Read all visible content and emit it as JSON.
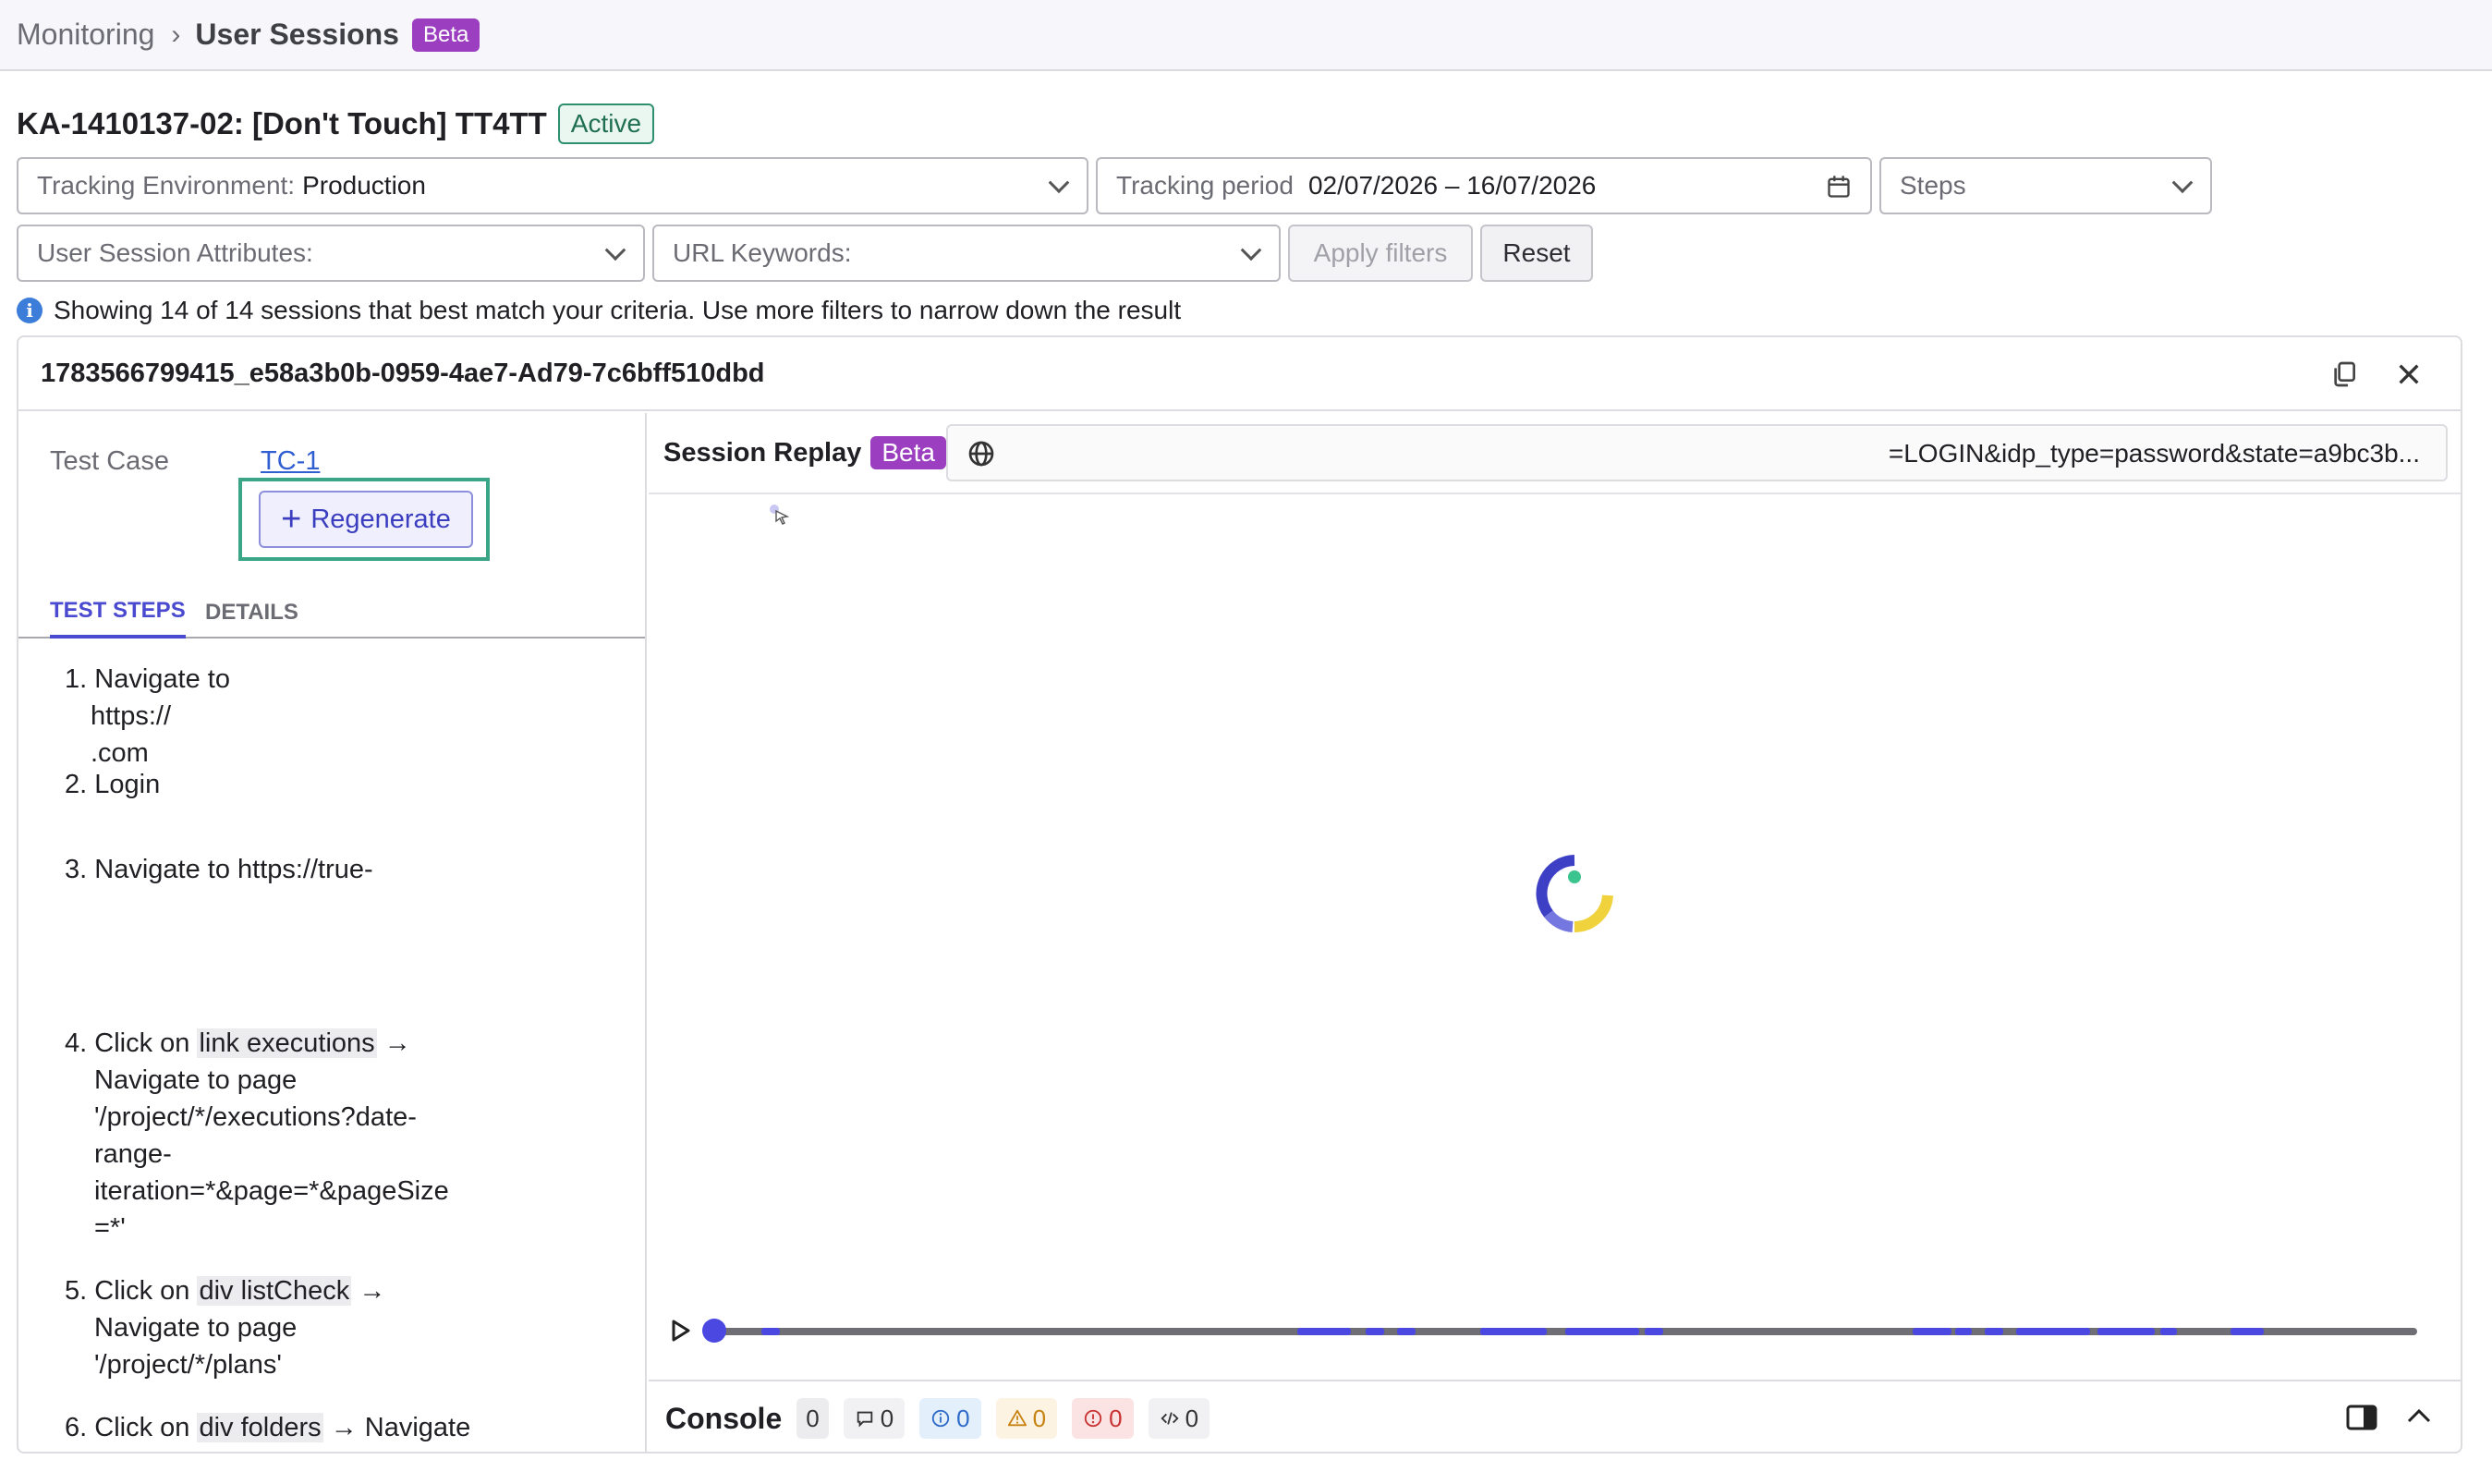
{
  "breadcrumb": {
    "parent": "Monitoring",
    "separator": "›",
    "current": "User Sessions",
    "badge": "Beta"
  },
  "project": {
    "title": "KA-1410137-02: [Don't Touch] TT4TT",
    "status": "Active"
  },
  "filters": {
    "environment_label": "Tracking Environment:",
    "environment_value": "Production",
    "period_label": "Tracking period",
    "period_value": "02/07/2026 – 16/07/2026",
    "steps_label": "Steps",
    "attributes_label": "User Session Attributes:",
    "url_keywords_label": "URL Keywords:",
    "apply_label": "Apply filters",
    "reset_label": "Reset"
  },
  "info_text": "Showing 14 of 14 sessions that best match your criteria. Use more filters to narrow down the result",
  "session": {
    "id": "1783566799415_e58a3b0b-0959-4ae7-Ad79-7c6bff510dbd",
    "test_case_label": "Test Case",
    "test_case_link": "TC-1",
    "regenerate_label": "Regenerate",
    "tabs": [
      "TEST STEPS",
      "DETAILS"
    ],
    "steps": {
      "s1": {
        "num": "1.",
        "text": "Navigate to",
        "line2": "https://",
        "line3": ".com"
      },
      "s2": {
        "num": "2.",
        "text": "Login"
      },
      "s3": {
        "num": "3.",
        "text": "Navigate to https://true-"
      },
      "s4": {
        "num": "4.",
        "pre": "Click on",
        "hl": "link executions",
        "post": "→",
        "l2": "Navigate to page",
        "l3": "'/project/*/executions?date-",
        "l4": "range-",
        "l5": "iteration=*&page=*&pageSize",
        "l6": "=*'"
      },
      "s5": {
        "num": "5.",
        "pre": "Click on",
        "hl": "div listCheck",
        "post": "→",
        "l2": "Navigate to page",
        "l3": "'/project/*/plans'"
      },
      "s6": {
        "num": "6.",
        "pre": "Click on",
        "hl": "div folders",
        "post": "→ Navigate"
      }
    }
  },
  "replay": {
    "title": "Session Replay",
    "badge": "Beta",
    "url": "=LOGIN&idp_type=password&state=a9bc3b..."
  },
  "console": {
    "title": "Console",
    "total": "0",
    "messages": "0",
    "info": "0",
    "warnings": "0",
    "errors": "0",
    "network": "0"
  },
  "colors": {
    "accent": "#4a48e0",
    "beta": "#9b3fc0",
    "active": "#2f8f6f",
    "highlight_frame": "#3aa687"
  },
  "icons": [
    "chevron-right-icon",
    "chevron-down-icon",
    "calendar-icon",
    "info-icon",
    "copy-icon",
    "close-icon",
    "plus-icon",
    "globe-icon",
    "cursor-icon",
    "loading-spinner-icon",
    "play-icon",
    "comment-icon",
    "info-circle-icon",
    "warning-icon",
    "error-icon",
    "code-icon",
    "panel-toggle-icon",
    "chevron-up-icon"
  ]
}
